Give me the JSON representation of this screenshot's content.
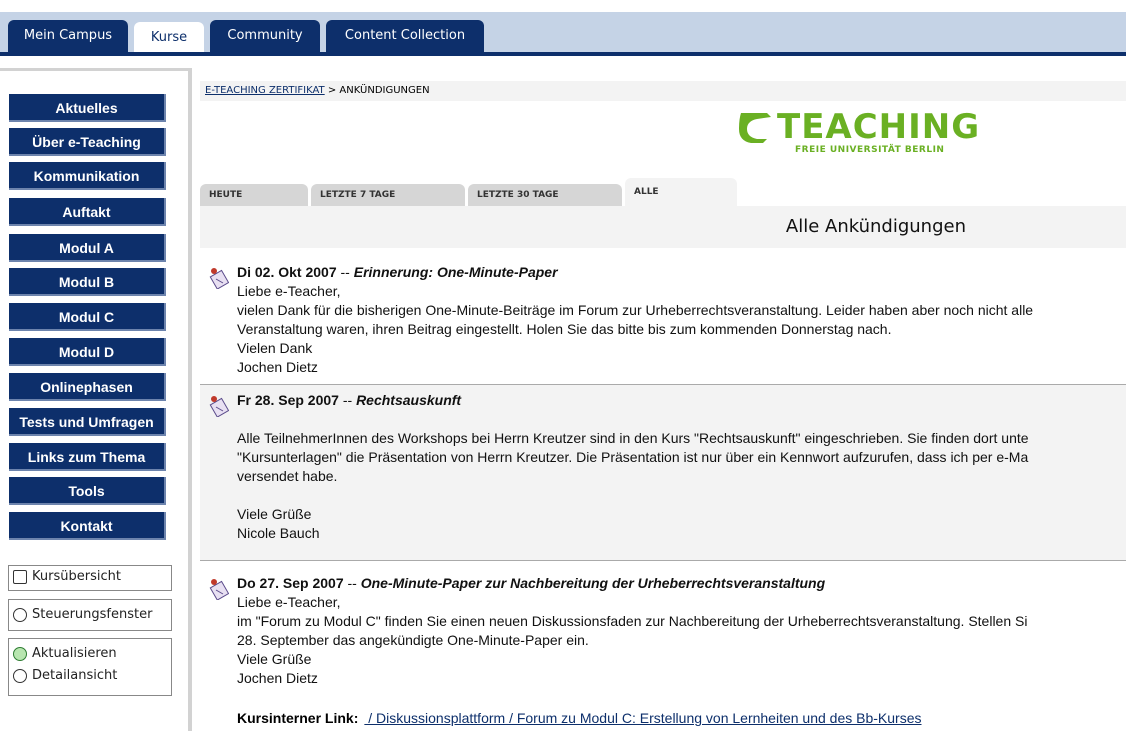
{
  "top_tabs": [
    {
      "label": "Mein Campus"
    },
    {
      "label": "Kurse"
    },
    {
      "label": "Community"
    },
    {
      "label": "Content Collection"
    }
  ],
  "nav": [
    {
      "label": "Aktuelles"
    },
    {
      "label": "Über e-Teaching"
    },
    {
      "label": "Kommunikation"
    },
    {
      "label": "Auftakt"
    },
    {
      "label": "Modul A"
    },
    {
      "label": "Modul B"
    },
    {
      "label": "Modul C"
    },
    {
      "label": "Modul D"
    },
    {
      "label": "Onlinephasen"
    },
    {
      "label": "Tests und Umfragen"
    },
    {
      "label": "Links zum Thema"
    },
    {
      "label": "Tools"
    },
    {
      "label": "Kontakt"
    }
  ],
  "tools": {
    "overview": "Kursübersicht",
    "control": "Steuerungsfenster",
    "refresh": "Aktualisieren",
    "detail": "Detailansicht"
  },
  "breadcrumb": {
    "course": "E-TEACHING ZERTIFIKAT",
    "separator": " > ",
    "current": "ANKÜNDIGUNGEN"
  },
  "logo": {
    "title": "TEACHING",
    "subtitle": "FREIE UNIVERSITÄT BERLIN"
  },
  "filter_tabs": [
    {
      "label": "HEUTE"
    },
    {
      "label": "LETZTE 7 TAGE"
    },
    {
      "label": "LETZTE 30 TAGE"
    },
    {
      "label": "ALLE"
    }
  ],
  "page_title": "Alle Ankündigungen",
  "announcements": [
    {
      "date": "Di 02. Okt 2007",
      "dash": " -- ",
      "title": "Erinnerung: One-Minute-Paper",
      "lines": [
        "Liebe e-Teacher,",
        "vielen Dank für die bisherigen One-Minute-Beiträge im Forum zur Urheberrechtsveranstaltung. Leider haben aber noch nicht alle",
        "Veranstaltung waren, ihren Beitrag eingestellt. Holen Sie das bitte bis zum kommenden Donnerstag nach.",
        "Vielen Dank",
        "Jochen Dietz"
      ]
    },
    {
      "date": "Fr 28. Sep 2007",
      "dash": " -- ",
      "title": "Rechtsauskunft",
      "lines": [
        "",
        "Alle TeilnehmerInnen des Workshops bei Herrn Kreutzer sind in den Kurs \"Rechtsauskunft\" eingeschrieben. Sie finden dort unte",
        "\"Kursunterlagen\" die Präsentation von Herrn Kreutzer. Die Präsentation ist nur über ein Kennwort aufzurufen, dass ich per e-Ma",
        "versendet habe.",
        "",
        "Viele Grüße",
        "Nicole Bauch"
      ]
    },
    {
      "date": "Do 27. Sep 2007",
      "dash": " -- ",
      "title": "One-Minute-Paper zur Nachbereitung der Urheberrechtsveranstaltung",
      "lines": [
        "Liebe e-Teacher,",
        "im \"Forum zu Modul C\" finden Sie einen neuen Diskussionsfaden zur Nachbereitung der Urheberrechtsveranstaltung. Stellen Si",
        "28. September das angekündigte One-Minute-Paper ein.",
        "Viele Grüße",
        "Jochen Dietz"
      ],
      "link_label": "Kursinterner Link:",
      "link_text": " / Diskussionsplattform / Forum zu Modul C: Erstellung von Lernheiten und des Bb-Kurses"
    }
  ]
}
